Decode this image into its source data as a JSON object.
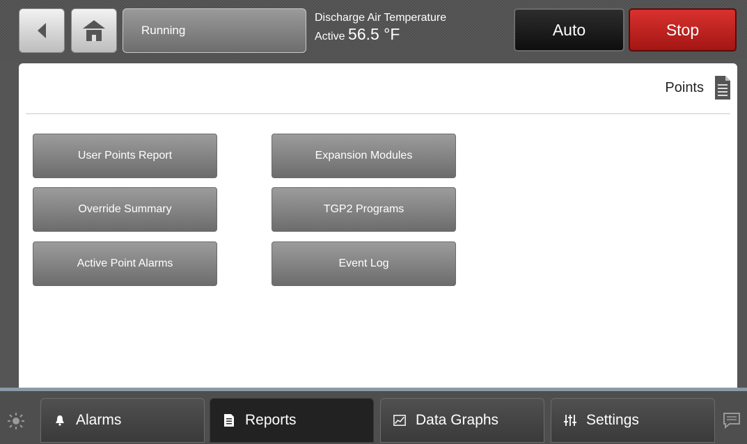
{
  "topbar": {
    "status_text": "Running",
    "temperature_title": "Discharge Air Temperature",
    "temperature_state": "Active",
    "temperature_value": "56.5 °F",
    "auto_label": "Auto",
    "stop_label": "Stop"
  },
  "section": {
    "title": "Points",
    "icon": "document-icon"
  },
  "menu": {
    "left": [
      "User Points Report",
      "Override Summary",
      "Active Point Alarms"
    ],
    "right": [
      "Expansion Modules",
      "TGP2 Programs",
      "Event Log"
    ]
  },
  "tabs": [
    {
      "label": "Alarms",
      "icon": "bell-icon"
    },
    {
      "label": "Reports",
      "icon": "report-icon"
    },
    {
      "label": "Data Graphs",
      "icon": "graph-icon"
    },
    {
      "label": "Settings",
      "icon": "sliders-icon"
    }
  ],
  "active_tab": "Reports",
  "colors": {
    "stop": "#c0211e",
    "auto": "#1a1a1a",
    "menu_button": "#848484"
  }
}
